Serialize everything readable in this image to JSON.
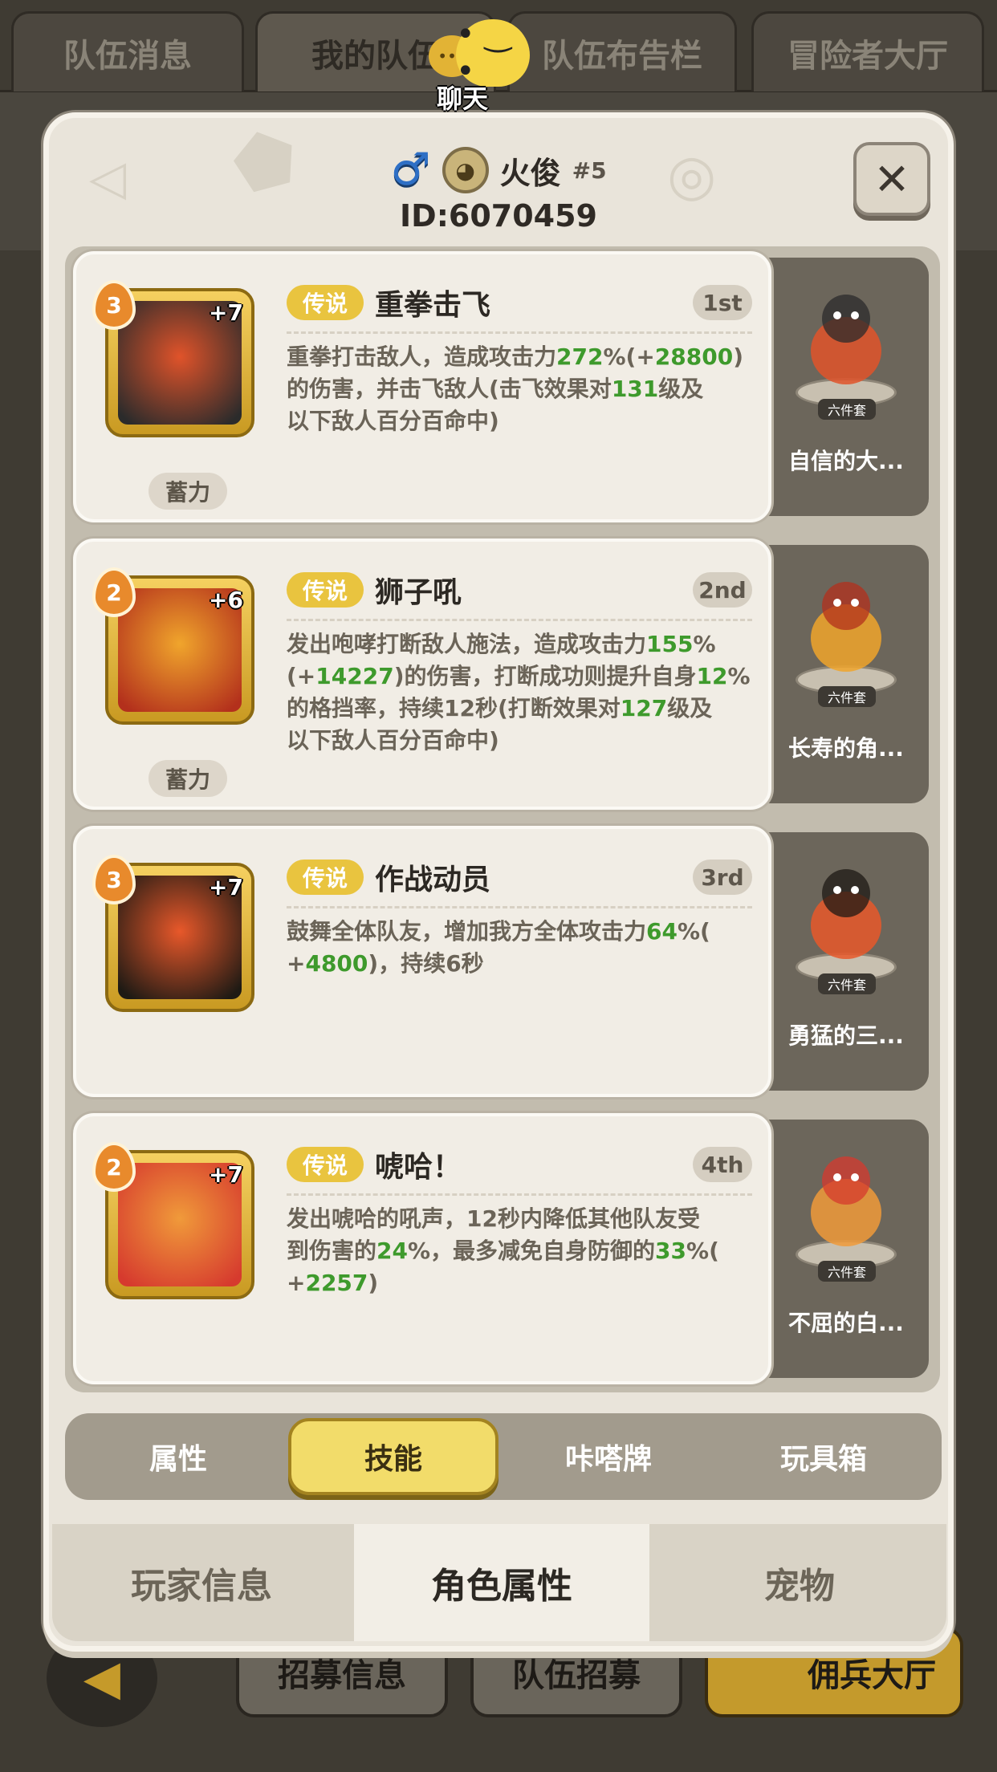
{
  "top_tabs": [
    "队伍消息",
    "我的队伍",
    "队伍布告栏",
    "冒险者大厅"
  ],
  "chat": {
    "label": "聊天"
  },
  "player": {
    "gender": "♂",
    "name": "火俊",
    "number": "#5",
    "id": "ID:6070459"
  },
  "close_label": "✕",
  "skills": [
    {
      "level": "3",
      "plus": "+7",
      "rarity": "传说",
      "name": "重拳击飞",
      "rank": "1st",
      "desc_parts": [
        {
          "t": "重拳打击敌人，造成攻击力"
        },
        {
          "t": "272",
          "g": true
        },
        {
          "t": "%(+"
        },
        {
          "t": "28800",
          "g": true
        },
        {
          "t": ")\n的伤害，并击飞敌人(击飞效果对"
        },
        {
          "t": "131",
          "g": true
        },
        {
          "t": "级及\n以下敌人百分百命中)"
        }
      ],
      "charge": "蓄力",
      "pet": {
        "name": "自信的大...",
        "set": "六件套"
      },
      "icon_colors": [
        "#e0532a",
        "#2b2b2b"
      ]
    },
    {
      "level": "2",
      "plus": "+6",
      "rarity": "传说",
      "name": "狮子吼",
      "rank": "2nd",
      "desc_parts": [
        {
          "t": "发出咆哮打断敌人施法，造成攻击力"
        },
        {
          "t": "155",
          "g": true
        },
        {
          "t": "%\n(+"
        },
        {
          "t": "14227",
          "g": true
        },
        {
          "t": ")的伤害，打断成功则提升自身"
        },
        {
          "t": "12",
          "g": true
        },
        {
          "t": "%\n的格挡率，持续12秒(打断效果对"
        },
        {
          "t": "127",
          "g": true
        },
        {
          "t": "级及\n以下敌人百分百命中)"
        }
      ],
      "charge": "蓄力",
      "pet": {
        "name": "长寿的角...",
        "set": "六件套"
      },
      "icon_colors": [
        "#f0a52c",
        "#b3301c"
      ]
    },
    {
      "level": "3",
      "plus": "+7",
      "rarity": "传说",
      "name": "作战动员",
      "rank": "3rd",
      "desc_parts": [
        {
          "t": "鼓舞全体队友，增加我方全体攻击力"
        },
        {
          "t": "64",
          "g": true
        },
        {
          "t": "%(\n+"
        },
        {
          "t": "4800",
          "g": true
        },
        {
          "t": ")，持续6秒"
        }
      ],
      "charge": "",
      "pet": {
        "name": "勇猛的三...",
        "set": "六件套"
      },
      "icon_colors": [
        "#e8582a",
        "#1e1a14"
      ]
    },
    {
      "level": "2",
      "plus": "+7",
      "rarity": "传说",
      "name": "唬哈！",
      "rank": "4th",
      "desc_parts": [
        {
          "t": "发出唬哈的吼声，12秒内降低其他队友受\n到伤害的"
        },
        {
          "t": "24",
          "g": true
        },
        {
          "t": "%，最多减免自身防御的"
        },
        {
          "t": "33",
          "g": true
        },
        {
          "t": "%(\n+"
        },
        {
          "t": "2257",
          "g": true
        },
        {
          "t": ")"
        }
      ],
      "charge": "",
      "pet": {
        "name": "不屈的白...",
        "set": "六件套"
      },
      "icon_colors": [
        "#f09a3a",
        "#d63a2e"
      ]
    }
  ],
  "inner_tabs": [
    "属性",
    "技能",
    "咔嗒牌",
    "玩具箱"
  ],
  "inner_tab_active": 1,
  "bottom_tabs": [
    "玩家信息",
    "角色属性",
    "宠物"
  ],
  "bottom_tab_active": 1,
  "bg_bottom_buttons": [
    "招募信息",
    "队伍招募",
    "佣兵大厅"
  ]
}
